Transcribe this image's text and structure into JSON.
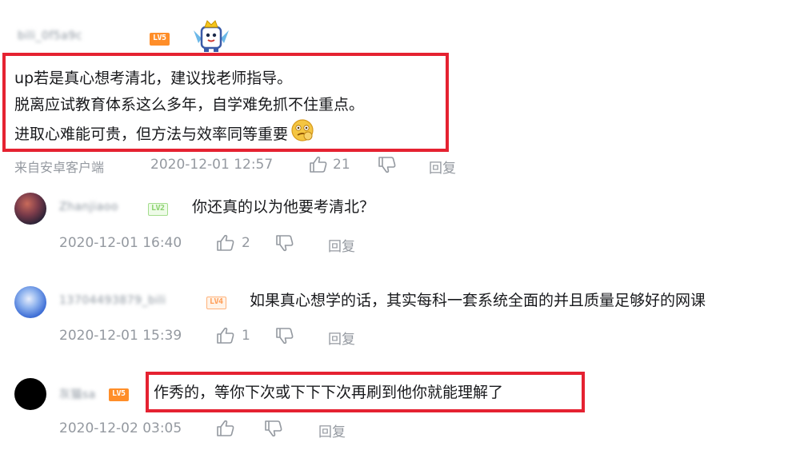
{
  "main_comment": {
    "username": "bili_0f5a9c",
    "level": "LV5",
    "text_lines": [
      "up若是真心想考清北，建议找老师指导。",
      "脱离应试教育体系这么多年，自学难免抓不住重点。",
      "进取心难能可贵，但方法与效率同等重要"
    ],
    "source": "来自安卓客户端",
    "time": "2020-12-01 12:57",
    "likes": "21",
    "reply_label": "回复"
  },
  "replies": [
    {
      "username": "Zhanjiaoo",
      "level": "LV2",
      "text": "你还真的以为他要考清北？",
      "time": "2020-12-01 16:40",
      "likes": "2",
      "reply_label": "回复"
    },
    {
      "username": "13704493879_bili",
      "level": "LV4",
      "text": "如果真心想学的话，其实每科一套系统全面的并且质量足够好的网课",
      "time": "2020-12-01 15:39",
      "likes": "1",
      "reply_label": "回复"
    },
    {
      "username": "灰猫sa",
      "level": "LV5",
      "text": "作秀的，等你下次或下下下次再刷到他你就能理解了",
      "time": "2020-12-02 03:05",
      "likes": "",
      "reply_label": "回复"
    }
  ],
  "colors": {
    "highlight": "#e52231",
    "meta_gray": "#9499a0",
    "lv5": "#ff8e29",
    "lv4": "#ff9d56",
    "lv2": "#8ad16e"
  },
  "icons": [
    "thumbs-up-icon",
    "thumbs-down-icon",
    "emoji-icon",
    "mascot-sticker"
  ]
}
